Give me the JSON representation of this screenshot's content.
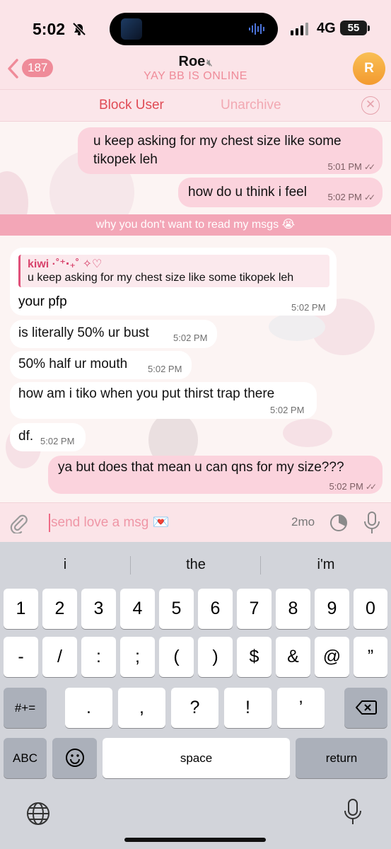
{
  "status_bar": {
    "time": "5:02",
    "network": "4G",
    "battery": "55"
  },
  "header": {
    "back_count": "187",
    "name": "Roe",
    "status": "YAY BB IS ONLINE",
    "avatar_letter": "R"
  },
  "actions": {
    "block": "Block User",
    "unarchive": "Unarchive",
    "close": "✕"
  },
  "messages": [
    {
      "dir": "out",
      "text_lines": [
        "u keep asking for my chest size like some",
        "tikopek leh"
      ],
      "time": "5:01 PM"
    },
    {
      "dir": "out",
      "text": "how do u think i feel",
      "time": "5:02 PM"
    },
    {
      "dir": "in",
      "reply_to": {
        "name": "kiwi ·˚⁺‧₊˚ ✧♡",
        "text": "u keep asking for my chest size like some tikopek leh"
      },
      "text": "your pfp",
      "time": "5:02 PM"
    },
    {
      "dir": "in",
      "text": "is literally 50% ur bust",
      "time": "5:02 PM"
    },
    {
      "dir": "in",
      "text": "50% half ur mouth",
      "time": "5:02 PM"
    },
    {
      "dir": "in",
      "text": "how am i tiko when you put thirst trap there",
      "time": "5:02 PM"
    },
    {
      "dir": "in",
      "text": "df.",
      "time": "5:02 PM"
    },
    {
      "dir": "out",
      "text": "ya but does that mean u can qns for my size???",
      "time": "5:02 PM"
    }
  ],
  "banner": "why you don't want to read my msgs 😭",
  "input": {
    "placeholder": "send love a msg 💌",
    "timer": "2mo"
  },
  "keyboard": {
    "suggestions": [
      "i",
      "the",
      "i'm"
    ],
    "row1": [
      "1",
      "2",
      "3",
      "4",
      "5",
      "6",
      "7",
      "8",
      "9",
      "0"
    ],
    "row2": [
      "-",
      "/",
      ":",
      ";",
      "(",
      ")",
      "$",
      "&",
      "@",
      "”"
    ],
    "row3": [
      ".",
      ",",
      "?",
      "!",
      "’"
    ],
    "sym_key": "#+=",
    "abc_key": "ABC",
    "emoji_key": "😊",
    "space": "space",
    "return": "return"
  },
  "colors": {
    "accent": "#ef8b99",
    "block": "#e04b55",
    "out_bubble": "#fbd3dd",
    "banner": "#f3a6b7"
  },
  "icons": [
    "chevron-left-icon",
    "bell-slash-icon",
    "speaker-mute-icon",
    "paperclip-icon",
    "timer-icon",
    "microphone-icon",
    "backspace-icon",
    "globe-icon",
    "emoji-icon"
  ]
}
